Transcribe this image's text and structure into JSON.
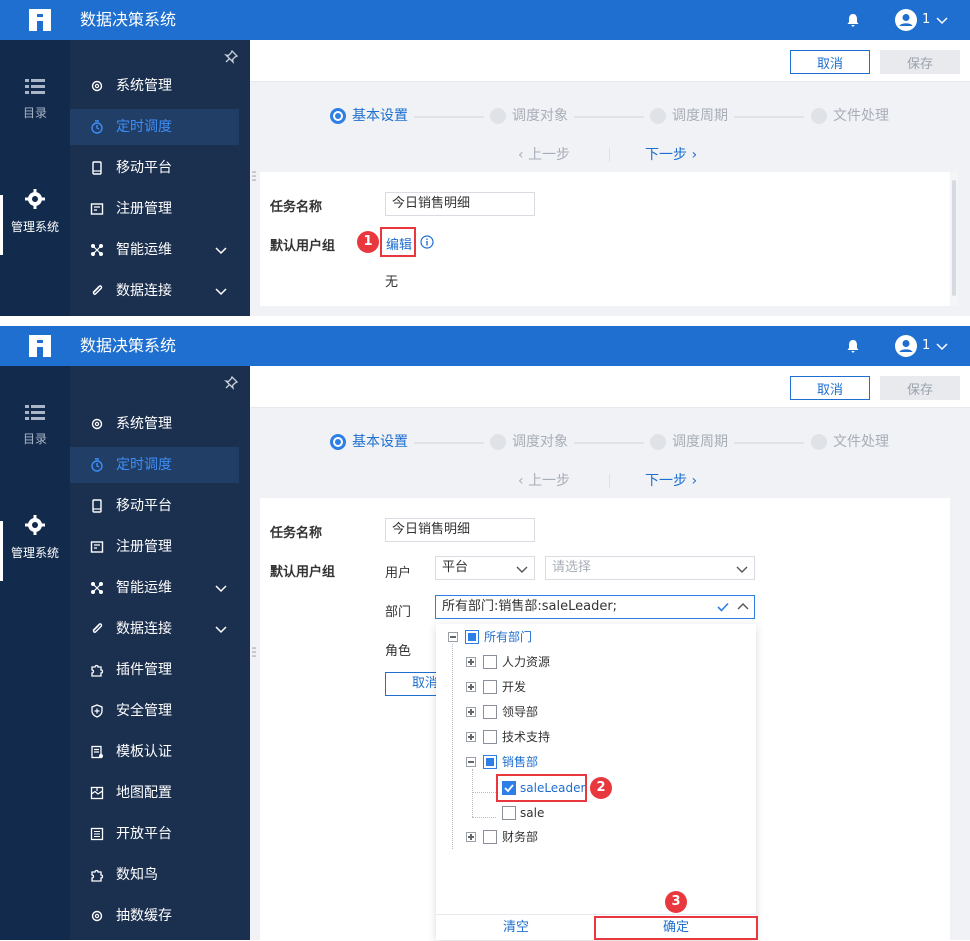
{
  "app": {
    "title": "数据决策系统",
    "user_name": "1",
    "accent_color": "#1e6fcf"
  },
  "rail": {
    "catalog_label": "目录",
    "admin_label": "管理系统"
  },
  "menu": {
    "items": [
      {
        "label": "系统管理",
        "icon": "gear-icon"
      },
      {
        "label": "定时调度",
        "icon": "timer-icon"
      },
      {
        "label": "移动平台",
        "icon": "mobile-icon"
      },
      {
        "label": "注册管理",
        "icon": "register-icon"
      },
      {
        "label": "智能运维",
        "icon": "nodes-icon"
      },
      {
        "label": "数据连接",
        "icon": "link-icon"
      },
      {
        "label": "插件管理",
        "icon": "puzzle-icon"
      },
      {
        "label": "安全管理",
        "icon": "shield-icon"
      },
      {
        "label": "模板认证",
        "icon": "certificate-icon"
      },
      {
        "label": "地图配置",
        "icon": "map-icon"
      },
      {
        "label": "开放平台",
        "icon": "list-icon"
      },
      {
        "label": "数知鸟",
        "icon": "puzzle-icon"
      },
      {
        "label": "抽数缓存",
        "icon": "gear-icon"
      }
    ],
    "active_index": 1
  },
  "toolbar": {
    "cancel_label": "取消",
    "save_label": "保存"
  },
  "steps": [
    {
      "label": "基本设置",
      "state": "active"
    },
    {
      "label": "调度对象",
      "state": "inactive"
    },
    {
      "label": "调度周期",
      "state": "inactive"
    },
    {
      "label": "文件处理",
      "state": "inactive"
    }
  ],
  "nav": {
    "prev_label": "上一步",
    "next_label": "下一步"
  },
  "form": {
    "task_name_label": "任务名称",
    "task_name_value": "今日销售明细",
    "user_group_label": "默认用户组",
    "edit_link": "编辑",
    "none_text": "无",
    "user_label": "用户",
    "platform_value": "平台",
    "select_placeholder": "请选择",
    "dept_label": "部门",
    "dept_value": "所有部门:销售部:saleLeader;",
    "role_label": "角色",
    "inline_cancel": "取消"
  },
  "tree": {
    "root": "所有部门",
    "nodes": [
      "人力资源",
      "开发",
      "领导部",
      "技术支持",
      "销售部",
      "saleLeader",
      "sale",
      "财务部"
    ],
    "clear_label": "清空",
    "ok_label": "确定"
  },
  "annotations": {
    "step1": "1",
    "step2": "2",
    "step3": "3"
  }
}
